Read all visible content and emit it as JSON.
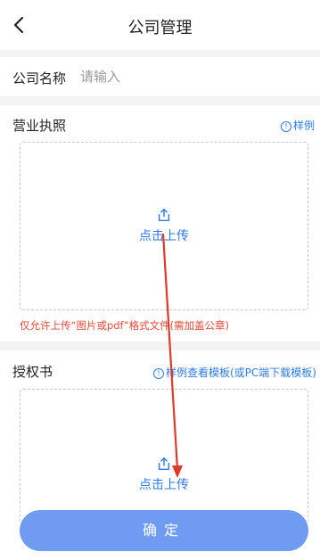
{
  "header": {
    "title": "公司管理",
    "back_icon": "chevron-left-icon"
  },
  "company_name": {
    "label": "公司名称",
    "placeholder": "请输入",
    "value": ""
  },
  "business_license": {
    "label": "营业执照",
    "sample_icon": "info-circle-icon",
    "sample_label": "样例",
    "upload_icon": "share-upload-icon",
    "upload_label": "点击上传",
    "note": "仅允许上传“图片或pdf”格式文件(需加盖公章)"
  },
  "authorization": {
    "label": "授权书",
    "sample_icon": "info-circle-icon",
    "sample_label": "样例",
    "template_label": "查看模板(或PC端下载模板)",
    "upload_icon": "share-upload-icon",
    "upload_label": "点击上传"
  },
  "confirm": {
    "label": "确定"
  },
  "colors": {
    "accent": "#2f7ae5",
    "button": "#6f9cf2",
    "warning": "#e84a3b",
    "annotation_arrow": "#e0382b"
  }
}
